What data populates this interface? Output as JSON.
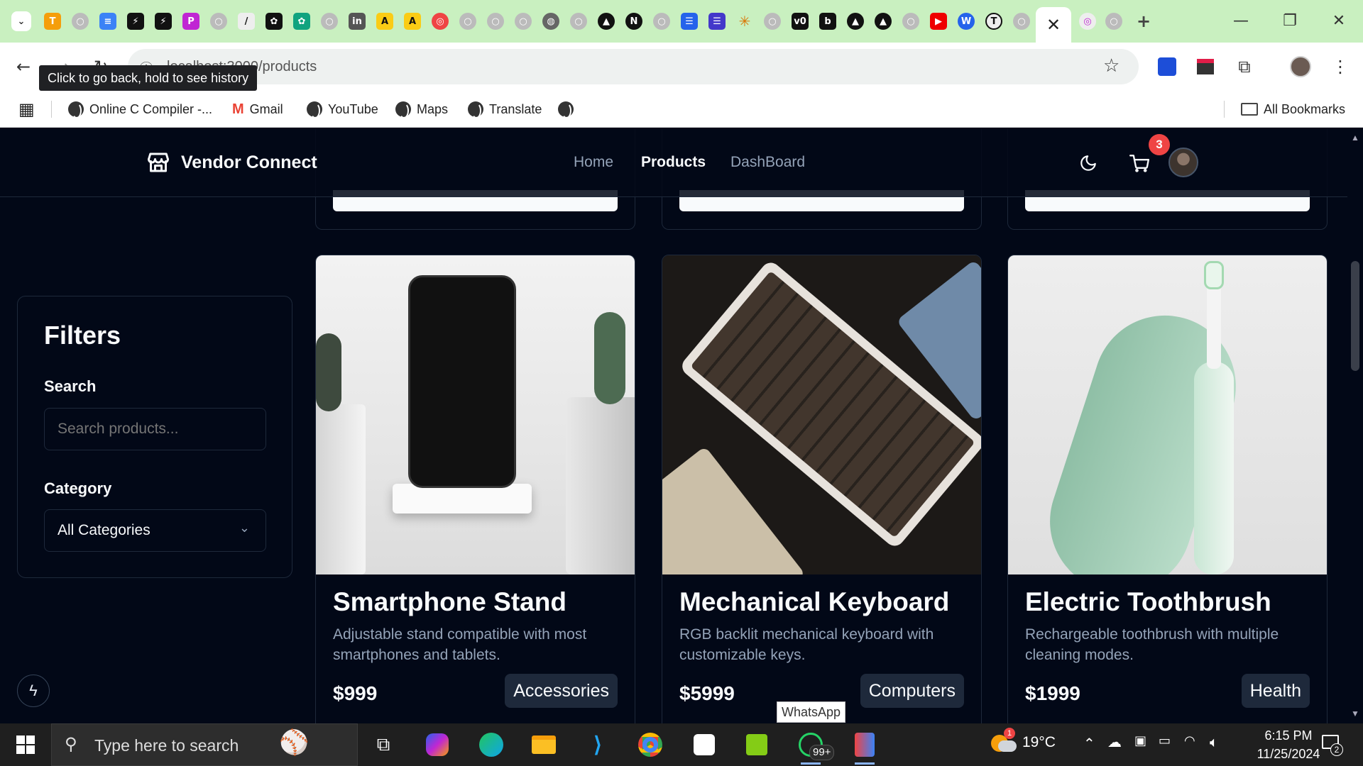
{
  "browser": {
    "url": "localhost:3000/products",
    "back_tooltip": "Click to go back, hold to see history",
    "bookmarks": [
      {
        "label": "Online C Compiler -..."
      },
      {
        "label": "Gmail"
      },
      {
        "label": "YouTube"
      },
      {
        "label": "Maps"
      },
      {
        "label": "Translate"
      }
    ],
    "all_bookmarks": "All Bookmarks"
  },
  "app": {
    "brand": "Vendor Connect",
    "nav": {
      "home": "Home",
      "products": "Products",
      "dashboard": "DashBoard"
    },
    "cart_count": "3"
  },
  "filters": {
    "title": "Filters",
    "search_label": "Search",
    "search_placeholder": "Search products...",
    "category_label": "Category",
    "category_value": "All Categories"
  },
  "products": [
    {
      "name": "Smartphone Stand",
      "description": "Adjustable stand compatible with most smartphones and tablets.",
      "price": "$999",
      "category": "Accessories"
    },
    {
      "name": "Mechanical Keyboard",
      "description": "RGB backlit mechanical keyboard with customizable keys.",
      "price": "$5999",
      "category": "Computers"
    },
    {
      "name": "Electric Toothbrush",
      "description": "Rechargeable toothbrush with multiple cleaning modes.",
      "price": "$1999",
      "category": "Health"
    }
  ],
  "taskbar": {
    "search_placeholder": "Type here to search",
    "whatsapp_tooltip": "WhatsApp",
    "whatsapp_badge": "99+",
    "weather_temp": "19°C",
    "weather_alert": "1",
    "time": "6:15 PM",
    "date": "11/25/2024",
    "notifications": "2"
  },
  "colors": {
    "page_bg": "#020817",
    "border": "#1e293b",
    "badge_red": "#ef4444",
    "tab_strip": "#c9f0c0"
  }
}
